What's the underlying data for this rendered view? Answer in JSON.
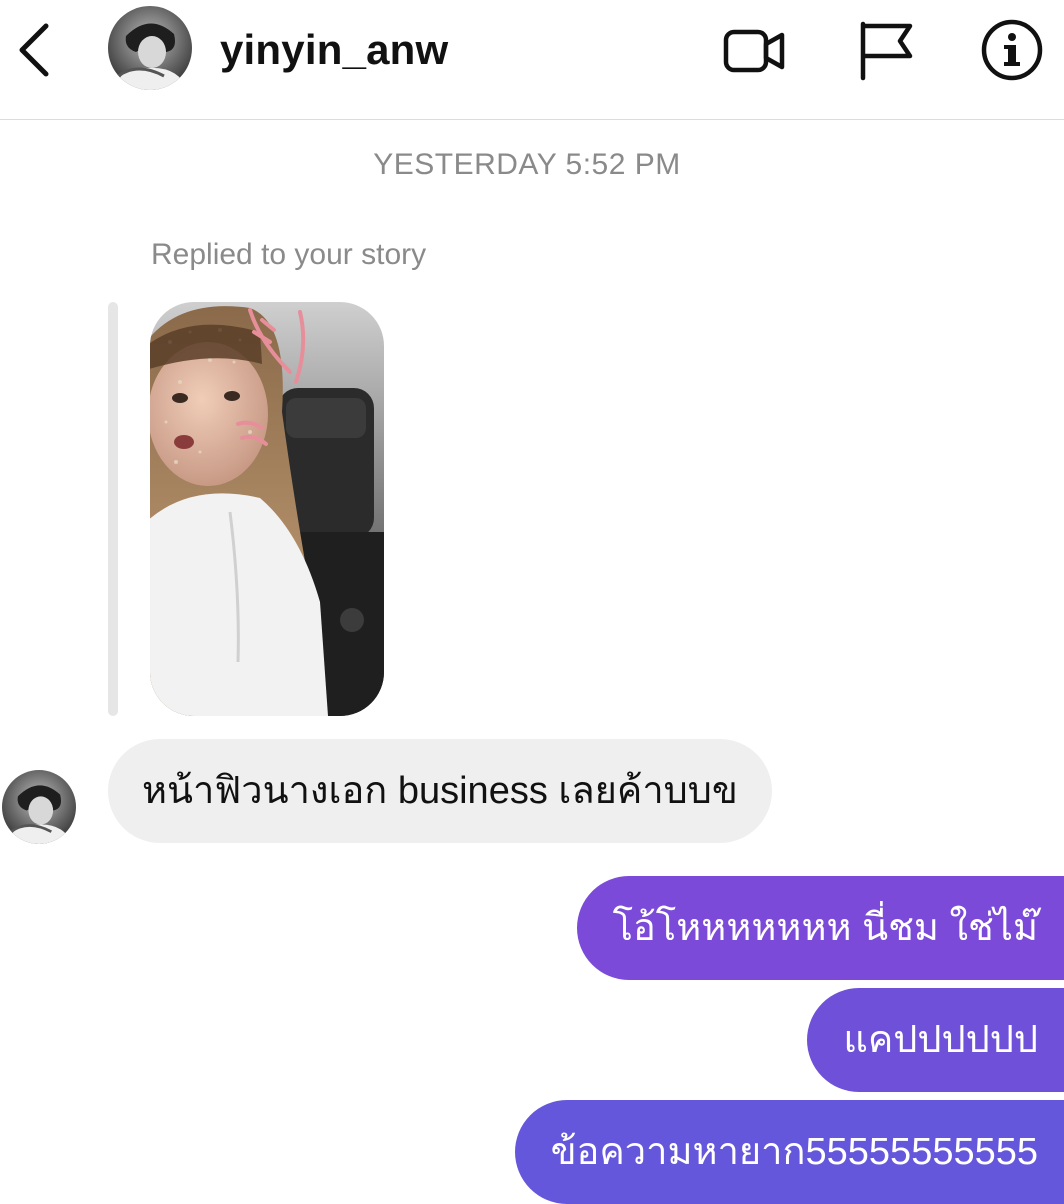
{
  "header": {
    "username": "yinyin_anw",
    "icons": {
      "back": "chevron-left-icon",
      "video": "video-camera-icon",
      "flag": "flag-icon",
      "info": "info-icon"
    }
  },
  "thread": {
    "timestamp": "YESTERDAY 5:52 PM",
    "reply_label": "Replied to your story",
    "incoming": [
      {
        "text": "หน้าฟิวนางเอก business เลยค้าบบข"
      }
    ],
    "outgoing": [
      {
        "text": "โอ้โหหหหหหห นี่ชม ใช่ไม๊"
      },
      {
        "text": "แคปปปปปป"
      },
      {
        "text": "ข้อความหายาก55555555555"
      }
    ]
  },
  "colors": {
    "incoming_bubble": "#efefef",
    "outgoing_gradient": [
      "#7b4ad8",
      "#6f50d9",
      "#6557db"
    ],
    "meta_text": "#8a8a8a"
  }
}
